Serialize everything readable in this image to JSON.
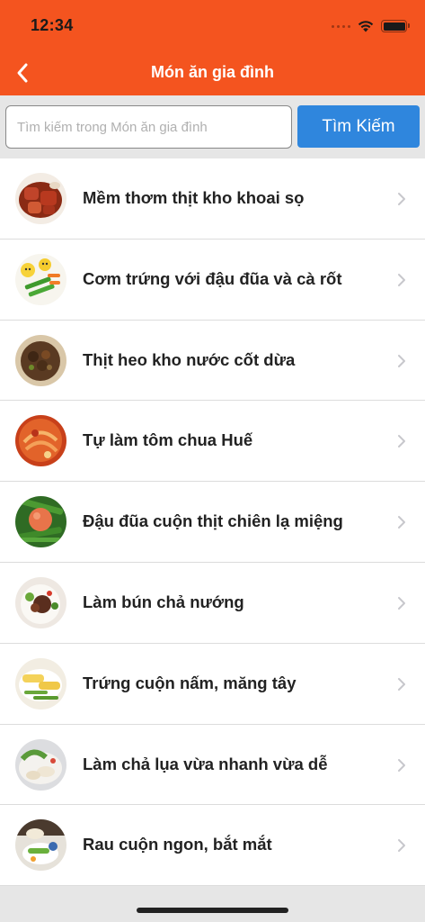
{
  "status_bar": {
    "time": "12:34"
  },
  "nav": {
    "title": "Món ăn gia đình"
  },
  "search": {
    "placeholder": "Tìm kiếm trong Món ăn gia đình",
    "value": "",
    "button_label": "Tìm Kiếm"
  },
  "colors": {
    "header": "#f4541f",
    "search_button": "#2f86dd",
    "background": "#e6e6e6"
  },
  "recipes": [
    {
      "title": "Mềm thơm thịt kho khoai sọ"
    },
    {
      "title": "Cơm trứng với đậu đũa và cà rốt"
    },
    {
      "title": "Thịt heo kho nước cốt dừa"
    },
    {
      "title": "Tự làm tôm chua Huế"
    },
    {
      "title": "Đậu đũa cuộn thịt chiên lạ miệng"
    },
    {
      "title": "Làm bún chả nướng"
    },
    {
      "title": "Trứng cuộn nấm, măng tây"
    },
    {
      "title": "Làm chả lụa vừa nhanh vừa dễ"
    },
    {
      "title": "Rau cuộn ngon, bắt mắt"
    }
  ]
}
